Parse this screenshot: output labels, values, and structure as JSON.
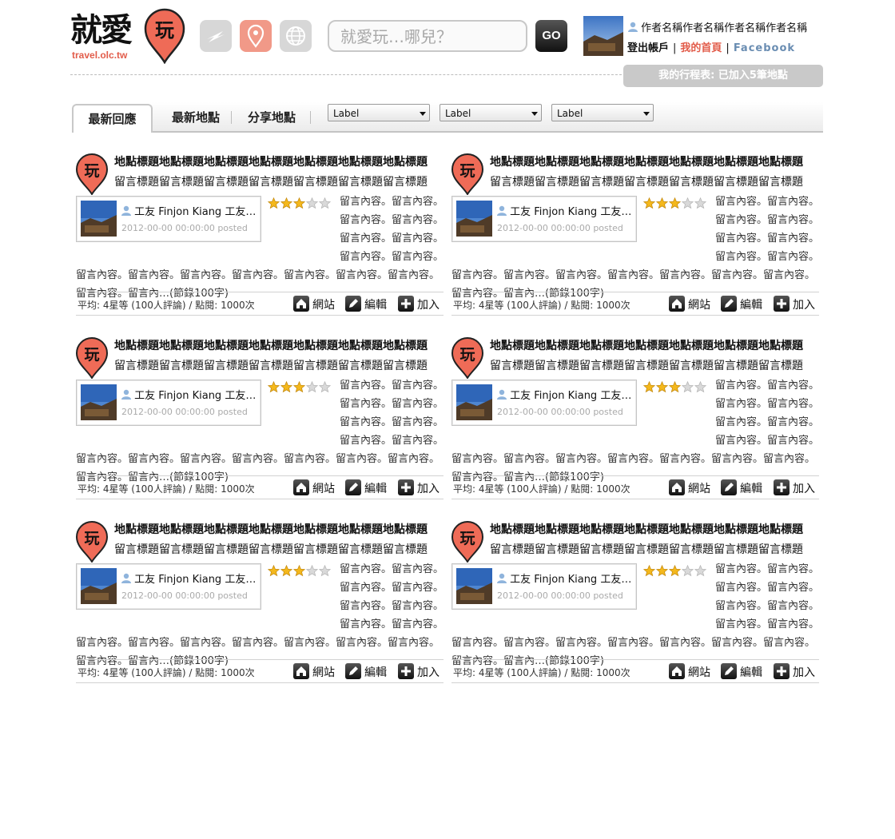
{
  "header": {
    "logo_text": "就愛",
    "logo_pin_text": "玩",
    "logo_sub": "travel.olc.tw",
    "search_placeholder": "就愛玩…哪兒？",
    "go_label": "GO",
    "user_name": "作者名稱作者名稱作者名稱作者名稱",
    "links": {
      "logout": "登出帳戶",
      "home": "我的首頁",
      "facebook": "Facebook",
      "separator": "|"
    },
    "trip_button": "我的行程表: 已加入5筆地點"
  },
  "tabs": [
    {
      "label": "最新回應",
      "active": true
    },
    {
      "label": "最新地點",
      "active": false
    },
    {
      "label": "分享地點",
      "active": false
    }
  ],
  "filters": [
    {
      "selected": "Label"
    },
    {
      "selected": "Label"
    },
    {
      "selected": "Label"
    }
  ],
  "colors": {
    "accent": "#e25c4a",
    "pin": "#ef6b57",
    "muted": "#aaaaaa"
  },
  "cards": [
    {
      "title": "地點標題地點標題地點標題地點標題地點標題地點標題地點標題",
      "subtitle": "留言標題留言標題留言標題留言標題留言標題留言標題留言標題",
      "author": "工友 Finjon Kiang 工友 Finjon Kiang",
      "posted": "2012-00-00 00:00:00 posted",
      "rating": 3,
      "body": "留言內容。留言內容。留言內容。留言內容。留言內容。留言內容。留言內容。留言內容。留言內容。留言內容。留言內容。留言內容。留言內容。留言內容。留言內容。留言內容。留言內…(節錄100字)",
      "stats": "平均: 4星等 (100人評論) / 點閱: 1000次",
      "actions": {
        "site": "網站",
        "edit": "編輯",
        "add": "加入"
      }
    },
    {
      "title": "地點標題地點標題地點標題地點標題地點標題地點標題地點標題",
      "subtitle": "留言標題留言標題留言標題留言標題留言標題留言標題留言標題",
      "author": "工友 Finjon Kiang 工友 Finjon Kiang",
      "posted": "2012-00-00 00:00:00 posted",
      "rating": 3,
      "body": "留言內容。留言內容。留言內容。留言內容。留言內容。留言內容。留言內容。留言內容。留言內容。留言內容。留言內容。留言內容。留言內容。留言內容。留言內容。留言內容。留言內…(節錄100字)",
      "stats": "平均: 4星等 (100人評論) / 點閱: 1000次",
      "actions": {
        "site": "網站",
        "edit": "編輯",
        "add": "加入"
      }
    },
    {
      "title": "地點標題地點標題地點標題地點標題地點標題地點標題地點標題",
      "subtitle": "留言標題留言標題留言標題留言標題留言標題留言標題留言標題",
      "author": "工友 Finjon Kiang 工友 Finjon Kiang",
      "posted": "2012-00-00 00:00:00 posted",
      "rating": 3,
      "body": "留言內容。留言內容。留言內容。留言內容。留言內容。留言內容。留言內容。留言內容。留言內容。留言內容。留言內容。留言內容。留言內容。留言內容。留言內容。留言內容。留言內…(節錄100字)",
      "stats": "平均: 4星等 (100人評論) / 點閱: 1000次",
      "actions": {
        "site": "網站",
        "edit": "編輯",
        "add": "加入"
      }
    },
    {
      "title": "地點標題地點標題地點標題地點標題地點標題地點標題地點標題",
      "subtitle": "留言標題留言標題留言標題留言標題留言標題留言標題留言標題",
      "author": "工友 Finjon Kiang 工友 Finjon Kiang",
      "posted": "2012-00-00 00:00:00 posted",
      "rating": 3,
      "body": "留言內容。留言內容。留言內容。留言內容。留言內容。留言內容。留言內容。留言內容。留言內容。留言內容。留言內容。留言內容。留言內容。留言內容。留言內容。留言內容。留言內…(節錄100字)",
      "stats": "平均: 4星等 (100人評論) / 點閱: 1000次",
      "actions": {
        "site": "網站",
        "edit": "編輯",
        "add": "加入"
      }
    },
    {
      "title": "地點標題地點標題地點標題地點標題地點標題地點標題地點標題",
      "subtitle": "留言標題留言標題留言標題留言標題留言標題留言標題留言標題",
      "author": "工友 Finjon Kiang 工友 Finjon Kiang",
      "posted": "2012-00-00 00:00:00 posted",
      "rating": 3,
      "body": "留言內容。留言內容。留言內容。留言內容。留言內容。留言內容。留言內容。留言內容。留言內容。留言內容。留言內容。留言內容。留言內容。留言內容。留言內容。留言內容。留言內…(節錄100字)",
      "stats": "平均: 4星等 (100人評論) / 點閱: 1000次",
      "actions": {
        "site": "網站",
        "edit": "編輯",
        "add": "加入"
      }
    },
    {
      "title": "地點標題地點標題地點標題地點標題地點標題地點標題地點標題",
      "subtitle": "留言標題留言標題留言標題留言標題留言標題留言標題留言標題",
      "author": "工友 Finjon Kiang 工友 Finjon Kiang",
      "posted": "2012-00-00 00:00:00 posted",
      "rating": 3,
      "body": "留言內容。留言內容。留言內容。留言內容。留言內容。留言內容。留言內容。留言內容。留言內容。留言內容。留言內容。留言內容。留言內容。留言內容。留言內容。留言內容。留言內…(節錄100字)",
      "stats": "平均: 4星等 (100人評論) / 點閱: 1000次",
      "actions": {
        "site": "網站",
        "edit": "編輯",
        "add": "加入"
      }
    }
  ]
}
